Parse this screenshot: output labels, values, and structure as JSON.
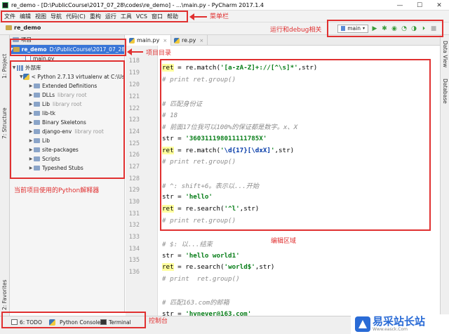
{
  "window": {
    "title": "re_demo - [D:\\PublicCourse\\2017_07_28\\codes\\re_demo] - ...\\main.py - PyCharm 2017.1.4",
    "min": "—",
    "max": "☐",
    "close": "✕"
  },
  "menu": [
    "文件",
    "编辑",
    "视图",
    "导航",
    "代码(C)",
    "重构",
    "运行",
    "工具",
    "VCS",
    "窗口",
    "帮助"
  ],
  "breadcrumb": "re_demo",
  "run": {
    "config": "main",
    "run_icon": "▶",
    "debug_icon": "✱",
    "coverage_icon": "◉",
    "profile_icon": "◔",
    "concurrency_icon": "◑",
    "stop_icon": "■"
  },
  "left_strip": {
    "project": "1: Project",
    "structure": "7: Structure",
    "favorites": "2: Favorites"
  },
  "right_strip": {
    "dataview": "Data View",
    "database": "Database"
  },
  "project_panel": {
    "header": "项目",
    "root": "re_demo",
    "root_path": "D:\\PublicCourse\\2017_07_28",
    "main_file": "main.py",
    "ext_libs": "外部库",
    "interpreter": "< Python 2.7.13 virtualenv at C:\\Use",
    "items": [
      {
        "name": "Extended Definitions",
        "note": ""
      },
      {
        "name": "DLLs",
        "note": "library root"
      },
      {
        "name": "Lib",
        "note": "library root"
      },
      {
        "name": "lib-tk",
        "note": ""
      },
      {
        "name": "Binary Skeletons",
        "note": ""
      },
      {
        "name": "django-env",
        "note": "library root"
      },
      {
        "name": "Lib",
        "note": ""
      },
      {
        "name": "site-packages",
        "note": ""
      },
      {
        "name": "Scripts",
        "note": ""
      },
      {
        "name": "Typeshed Stubs",
        "note": ""
      }
    ]
  },
  "tabs": [
    {
      "label": "main.py",
      "close": "×"
    },
    {
      "label": "re.py",
      "close": "×"
    }
  ],
  "line_numbers": [
    "118",
    "119",
    "120",
    "121",
    "122",
    "123",
    "124",
    "125",
    "126",
    "127",
    "128",
    "129",
    "130",
    "131",
    "132",
    "133",
    "134",
    "135",
    "136"
  ],
  "code": {
    "l118": {
      "a": "ret",
      "b": " = re.match(",
      "c": "'[a-zA-Z]+://[^\\s]*'",
      "d": ",str)"
    },
    "l119": "# print ret.group()",
    "l121": "# 匹配身份证",
    "l122": "# 18",
    "l123": "# 前面17位我可以100%的保证都是数字。x、X",
    "l124": {
      "a": "str = ",
      "b": "'360311198011111785X'"
    },
    "l125": {
      "a": "ret",
      "b": " = re.match(",
      "c1": "'",
      "c2": "\\d{17}[\\dxX]",
      "c3": "'",
      "d": ",str)"
    },
    "l126": "# print ret.group()",
    "l128": "# ^: shift+6。表示以...开始",
    "l129": {
      "a": "str = ",
      "b": "'hello'"
    },
    "l130": {
      "a": "ret",
      "b": " = re.search(",
      "c": "'^l'",
      "d": ",str)"
    },
    "l131": "# print ret.group()",
    "l133": "# $: 以...结束",
    "l134": {
      "a": "str = ",
      "b": "'hello world1'"
    },
    "l135": {
      "a": "ret",
      "b": " = re.search(",
      "c": "'world$'",
      "d": ",str)"
    },
    "l136": "# print  ret.group()",
    "l138": "# 匹配163.com的邮箱",
    "l139": {
      "a": "str = ",
      "b": "'hynever@163.com'"
    }
  },
  "bottom": {
    "todo": "6: TODO",
    "console": "Python Console",
    "terminal": "Terminal"
  },
  "annotations": {
    "menubar": "菜单栏",
    "run_debug": "运行和debug相关",
    "project_dir": "项目目录",
    "interpreter": "当前项目使用的Python解释器",
    "editor": "编辑区域",
    "console": "控制台"
  },
  "watermark": {
    "name": "易采站长站",
    "url": "Www.easck.Com"
  },
  "colors": {
    "annotation": "#e03030",
    "selection": "#3875d7",
    "string": "#067d17"
  }
}
